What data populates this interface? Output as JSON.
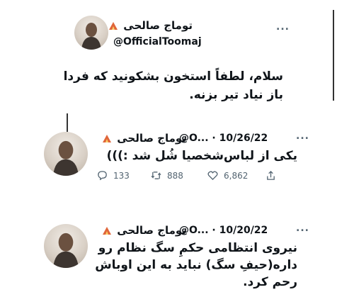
{
  "top": {
    "name": "توماج صالحی",
    "handle": "@OfficialToomaj",
    "more": "...",
    "text_line1": "سلام، لطفاً استخون بشکونید که فردا",
    "text_line2": "باز نیاد تیر بزنه."
  },
  "tweets": [
    {
      "name": "توماج صالحی",
      "handle_date": "@O... · 10/26/22",
      "more": "...",
      "text_line1": "یکی از لباس‌شخصیا شُل شد :)))",
      "replies": "133",
      "retweets": "888",
      "likes": "6,862"
    },
    {
      "name": "توماج صالحی",
      "handle_date": "@O... · 10/20/22",
      "more": "...",
      "text_line1": "نیروی انتظامی حکمِ سگ نظام رو",
      "text_line2": "داره(حیفِ سگ) نباید به این اوباش",
      "text_line3": "رحم کرد."
    }
  ],
  "colors": {
    "text": "#0f1419",
    "muted": "#536471",
    "flame": "#e0663a"
  },
  "icons": [
    "flame-icon",
    "more-icon",
    "reply-icon",
    "retweet-icon",
    "like-icon",
    "share-icon"
  ]
}
